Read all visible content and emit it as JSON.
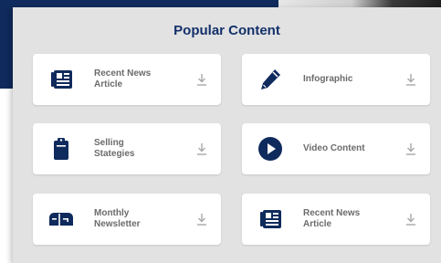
{
  "panel": {
    "title": "Popular Content"
  },
  "cards": [
    {
      "label": "Recent News\nArticle",
      "icon": "newspaper-icon"
    },
    {
      "label": "Infographic",
      "icon": "pen-icon"
    },
    {
      "label": "Selling\nStategies",
      "icon": "clipboard-icon"
    },
    {
      "label": "Video Content",
      "icon": "play-circle-icon"
    },
    {
      "label": "Monthly\nNewsletter",
      "icon": "mailbox-icon"
    },
    {
      "label": "Recent News\nArticle",
      "icon": "newspaper-icon"
    }
  ],
  "colors": {
    "navy": "#0f2a5c",
    "title": "#13306a",
    "panel": "#e2e2e2",
    "label": "#6b6b6b",
    "download": "#a8a8a8"
  }
}
